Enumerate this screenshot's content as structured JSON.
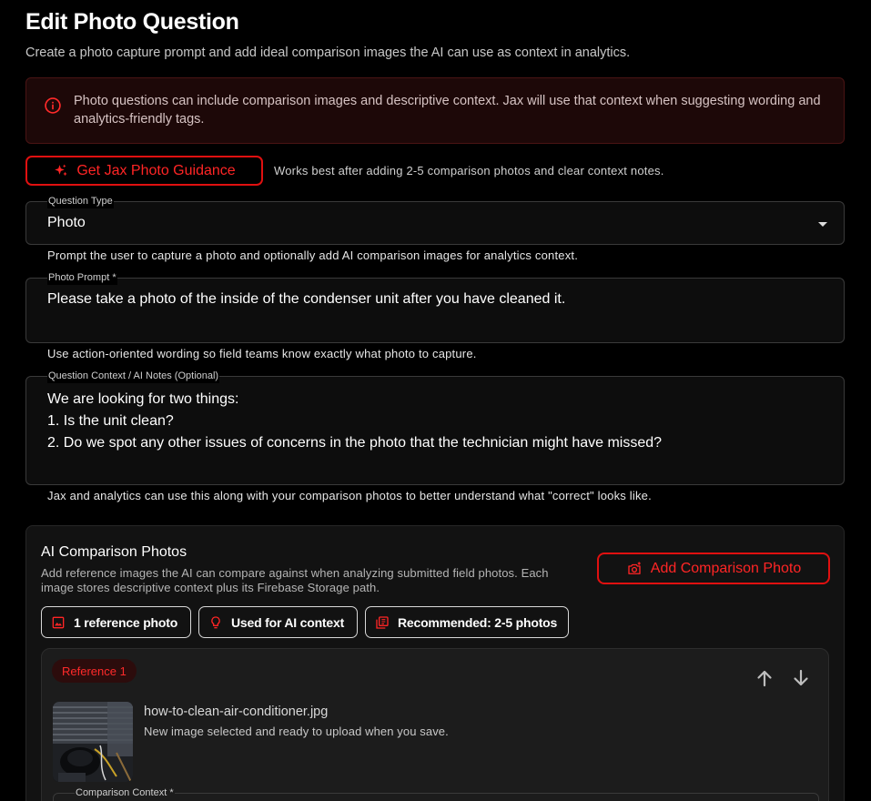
{
  "header": {
    "title": "Edit Photo Question",
    "subtitle": "Create a photo capture prompt and add ideal comparison images the AI can use as context in analytics."
  },
  "alert": {
    "text": "Photo questions can include comparison images and descriptive context. Jax will use that context when suggesting wording and analytics-friendly tags.",
    "icon": "info-icon"
  },
  "guidance": {
    "button_label": "Get Jax Photo Guidance",
    "hint": "Works best after adding 2-5 comparison photos and clear context notes."
  },
  "question_type": {
    "label": "Question Type",
    "value": "Photo",
    "helper": "Prompt the user to capture a photo and optionally add AI comparison images for analytics context."
  },
  "photo_prompt": {
    "label": "Photo Prompt *",
    "value": "Please take a photo of the inside of the condenser unit after you have cleaned it.",
    "helper": "Use action-oriented wording so field teams know exactly what photo to capture."
  },
  "question_context": {
    "label": "Question Context / AI Notes (Optional)",
    "lines": [
      "We are looking for two things:",
      "1.  Is the unit clean?",
      "2.  Do we spot any other issues of concerns in the photo that the technician might have missed?"
    ],
    "helper": "Jax and analytics can use this along with your comparison photos to better understand what \"correct\" looks like."
  },
  "comparison": {
    "title": "AI Comparison Photos",
    "description": "Add reference images the AI can compare against when analyzing submitted field photos. Each image stores descriptive context plus its Firebase Storage path.",
    "add_button_label": "Add Comparison Photo",
    "chips": [
      {
        "label": "1 reference photo",
        "icon": "image-icon"
      },
      {
        "label": "Used for AI context",
        "icon": "lightbulb-icon"
      },
      {
        "label": "Recommended: 2-5 photos",
        "icon": "photo-library-icon"
      }
    ],
    "reference": {
      "badge": "Reference 1",
      "file_name": "how-to-clean-air-conditioner.jpg",
      "status": "New image selected and ready to upload when you save.",
      "context_label": "Comparison Context *"
    }
  },
  "colors": {
    "accent": "#e01010",
    "background": "#000000",
    "alert_bg": "#1d0808"
  }
}
